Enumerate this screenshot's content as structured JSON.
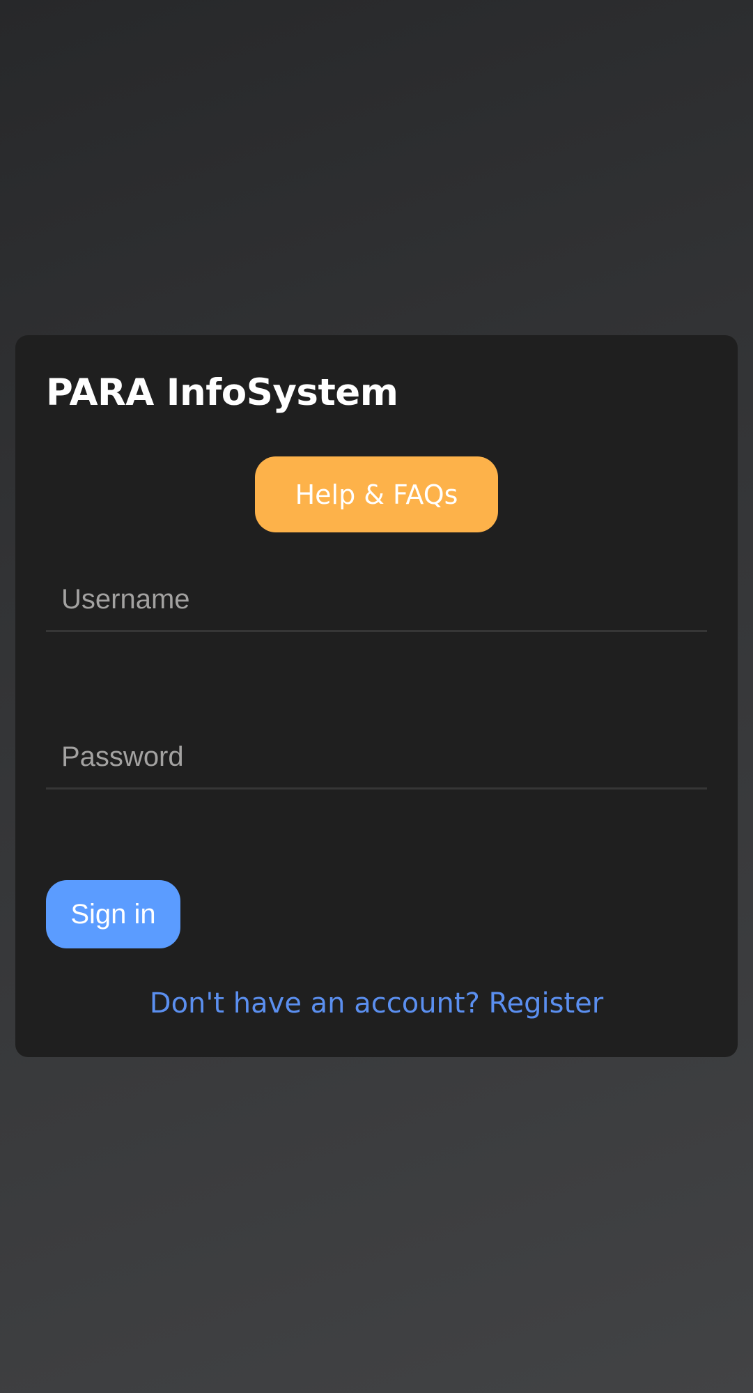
{
  "app": {
    "title": "PARA InfoSystem"
  },
  "help": {
    "label": "Help & FAQs"
  },
  "form": {
    "username": {
      "placeholder": "Username",
      "value": ""
    },
    "password": {
      "placeholder": "Password",
      "value": ""
    },
    "signin_label": "Sign in",
    "register_label": "Don't have an account? Register"
  },
  "colors": {
    "card_background": "#1f1f1f",
    "help_button": "#fdb24a",
    "signin_button": "#5b9cff",
    "link": "#5b8fef",
    "placeholder": "#a3a2a1"
  }
}
